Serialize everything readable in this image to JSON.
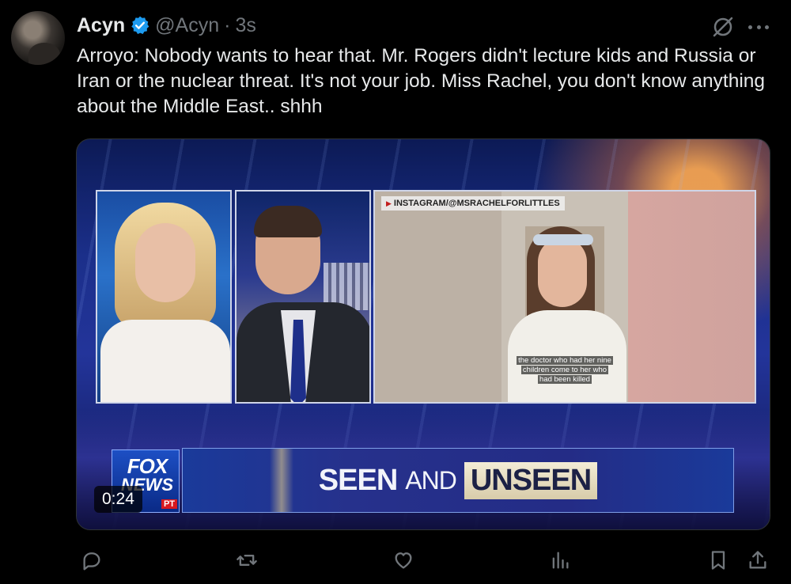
{
  "author": {
    "name": "Acyn",
    "handle": "@Acyn",
    "separator": "·",
    "time": "3s",
    "verified": true
  },
  "tweet": {
    "text": "Arroyo: Nobody wants to hear that. Mr. Rogers didn't lecture kids and Russia or Iran or the nuclear threat. It's not your job. Miss Rachel, you don't know anything about the Middle East.. shhh"
  },
  "media": {
    "duration": "0:24",
    "instagram_credit": "INSTAGRAM/@MSRACHELFORLITTLES",
    "caption_line1": "the doctor who had her nine",
    "caption_line2": "children come to her who",
    "caption_line3": "had been killed",
    "logo_fox": "FOX",
    "logo_news": "NEWS",
    "logo_tag": "PT",
    "banner_word1": "SEEN",
    "banner_word2": "AND",
    "banner_word3": "UNSEEN"
  },
  "icons": {
    "verified": "verified-badge-icon",
    "grok": "grok-icon",
    "more": "more-icon",
    "reply": "reply-icon",
    "retweet": "retweet-icon",
    "like": "like-icon",
    "views": "views-icon",
    "bookmark": "bookmark-icon",
    "share": "share-icon"
  },
  "colors": {
    "background": "#000000",
    "text": "#e7e9ea",
    "secondary": "#71767b",
    "verified": "#1d9bf0"
  }
}
